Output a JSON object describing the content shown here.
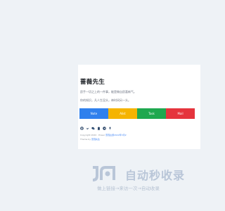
{
  "profile": {
    "name": "蔷薇先生",
    "motto_1": "愿手一切之上的一件事，能是做自愿喜新气。",
    "motto_2": "你的知识，凡人生没头，神时间另一头。"
  },
  "buttons": [
    {
      "label": "Note",
      "color": "#2f80ed"
    },
    {
      "label": "Alist",
      "color": "#f5b400"
    },
    {
      "label": "Task",
      "color": "#1fa84f"
    },
    {
      "label": "Mail",
      "color": "#e5343d"
    }
  ],
  "social_icons": [
    "github-icon",
    "twitter-icon",
    "wechat-icon",
    "qq-icon",
    "telegram-icon",
    "mic-icon"
  ],
  "footer": {
    "copyright_prefix": "Copyright 2020 · Power",
    "copyright_link": "蔷薇主题2022年3月2",
    "theme_prefix": "Theme by",
    "theme_link": "蔷薇先生"
  },
  "watermark": {
    "main": "自动秒收录",
    "sub": "做上链接→来访一次→自动收录"
  }
}
